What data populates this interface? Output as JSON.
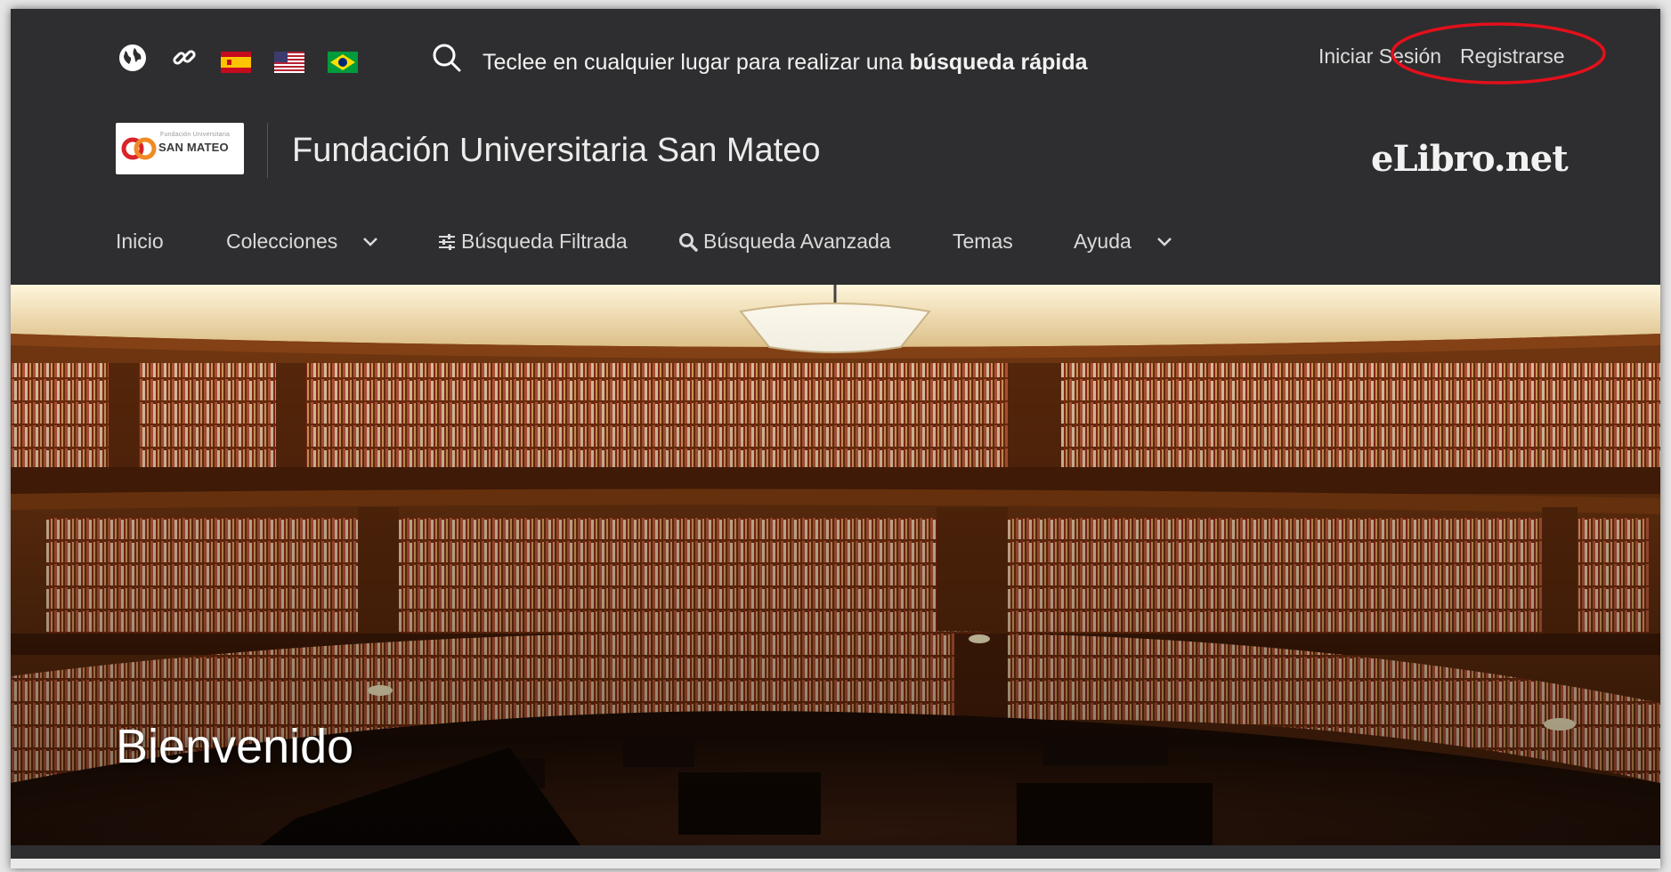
{
  "topbar": {
    "search_hint_prefix": "Teclee en cualquier lugar para realizar una ",
    "search_hint_bold": "búsqueda rápida",
    "login_label": "Iniciar Sesión",
    "register_label": "Registrarse",
    "icons": [
      "globe-icon",
      "link-icon",
      "flag-spain-icon",
      "flag-usa-icon",
      "flag-brazil-icon",
      "search-icon"
    ],
    "highlight_color": "#e3101b"
  },
  "brand": {
    "logo_small_text": "Fundación Universitaria",
    "logo_text": "SAN MATEO",
    "title": "Fundación Universitaria San Mateo",
    "provider": "eLibro.net"
  },
  "nav": {
    "items": [
      {
        "label": "Inicio"
      },
      {
        "label": "Colecciones",
        "icon": "chevron-down-icon"
      },
      {
        "label": "Búsqueda Filtrada",
        "icon": "sliders-icon"
      },
      {
        "label": "Búsqueda Avanzada",
        "icon": "search-icon"
      },
      {
        "label": "Temas"
      },
      {
        "label": "Ayuda",
        "icon": "chevron-down-icon"
      }
    ]
  },
  "hero": {
    "title": "Bienvenido"
  },
  "colors": {
    "header_bg": "#2e2e30",
    "text_light": "#dadada",
    "hero_wood": "#6b3511"
  }
}
